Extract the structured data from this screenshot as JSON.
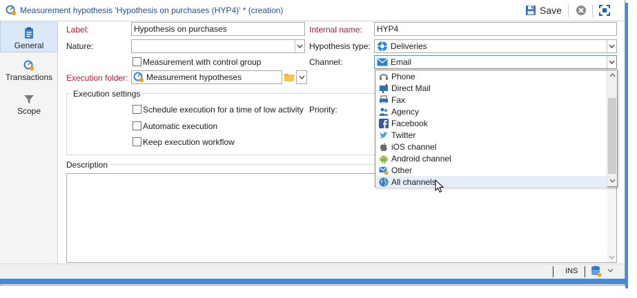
{
  "window": {
    "title": "Measurement hypothesis 'Hypothesis on purchases (HYP4)' * (creation)",
    "save_label": "Save"
  },
  "sidebar": {
    "items": [
      {
        "label": "General",
        "icon": "clipboard-icon",
        "active": true
      },
      {
        "label": "Transactions",
        "icon": "gauge-icon",
        "active": false
      },
      {
        "label": "Scope",
        "icon": "filter-icon",
        "active": false
      }
    ]
  },
  "form": {
    "label_caption": "Label:",
    "label_value": "Hypothesis on purchases",
    "nature_caption": "Nature:",
    "nature_value": "",
    "control_group_label": "Measurement with control group",
    "execution_folder_caption": "Execution folder:",
    "execution_folder_value": "Measurement hypotheses",
    "internal_name_caption": "Internal name:",
    "internal_name_value": "HYP4",
    "hypothesis_type_caption": "Hypothesis type:",
    "hypothesis_type_value": "Deliveries",
    "channel_caption": "Channel:",
    "channel_value": "Email"
  },
  "execution_settings": {
    "title": "Execution settings",
    "schedule_label": "Schedule execution for a time of low activity",
    "automatic_label": "Automatic execution",
    "keep_workflow_label": "Keep execution workflow",
    "priority_caption": "Priority:"
  },
  "description": {
    "caption": "Description",
    "value": ""
  },
  "channel_options": [
    {
      "label": "Phone",
      "icon": "phone-icon"
    },
    {
      "label": "Direct Mail",
      "icon": "direct-mail-icon"
    },
    {
      "label": "Fax",
      "icon": "fax-icon"
    },
    {
      "label": "Agency",
      "icon": "agency-icon"
    },
    {
      "label": "Facebook",
      "icon": "facebook-icon"
    },
    {
      "label": "Twitter",
      "icon": "twitter-icon"
    },
    {
      "label": "iOS channel",
      "icon": "apple-icon"
    },
    {
      "label": "Android channel",
      "icon": "android-icon"
    },
    {
      "label": "Other",
      "icon": "other-channel-icon"
    },
    {
      "label": "All channels",
      "icon": "globe-icon",
      "hovered": true
    }
  ],
  "statusbar": {
    "ins_label": "INS"
  },
  "colors": {
    "required_label": "#c8102e",
    "title_text": "#1f4e9a",
    "accent": "#4a8ad0",
    "active_tab_bg": "#dbe8f7"
  }
}
